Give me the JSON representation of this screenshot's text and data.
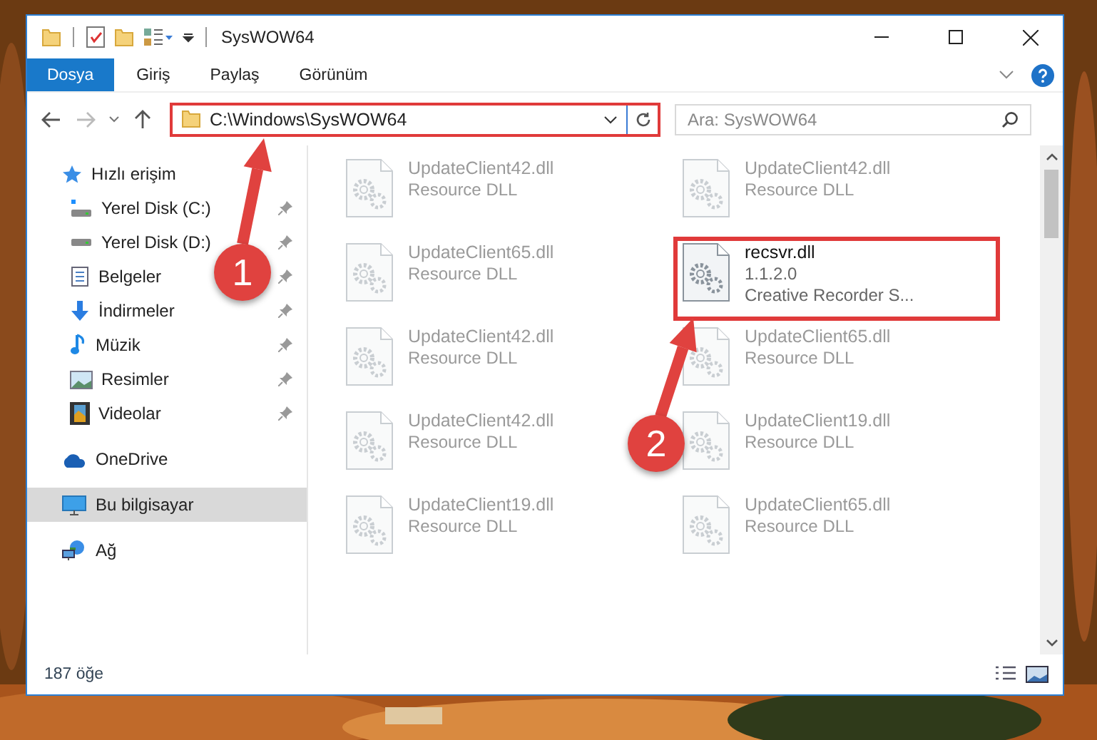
{
  "window": {
    "title": "SysWOW64"
  },
  "ribbon_tabs": [
    {
      "label": "Dosya",
      "selected": true
    },
    {
      "label": "Giriş",
      "selected": false
    },
    {
      "label": "Paylaş",
      "selected": false
    },
    {
      "label": "Görünüm",
      "selected": false
    }
  ],
  "navigation": {
    "back_disabled": false,
    "forward_disabled": true
  },
  "address": {
    "path": "C:\\Windows\\SysWOW64",
    "highlighted": true
  },
  "search": {
    "placeholder": "Ara: SysWOW64"
  },
  "sidebar": {
    "items": [
      {
        "label": "Hızlı erişim",
        "selected": false,
        "children": [
          {
            "label": "Yerel Disk (C:)",
            "pinned": true
          },
          {
            "label": "Yerel Disk (D:)",
            "pinned": true
          },
          {
            "label": "Belgeler",
            "pinned": true
          },
          {
            "label": "İndirmeler",
            "pinned": true
          },
          {
            "label": "Müzik",
            "pinned": true
          },
          {
            "label": "Resimler",
            "pinned": true
          },
          {
            "label": "Videolar",
            "pinned": true
          }
        ]
      },
      {
        "label": "OneDrive",
        "selected": false
      },
      {
        "label": "Bu bilgisayar",
        "selected": true
      },
      {
        "label": "Ağ",
        "selected": false
      }
    ]
  },
  "files": [
    {
      "name": "UpdateClient42.dll",
      "details": [
        "Resource DLL"
      ],
      "blurred": true,
      "highlighted": false
    },
    {
      "name": "UpdateClient42.dll",
      "details": [
        "Resource DLL"
      ],
      "blurred": true,
      "highlighted": false
    },
    {
      "name": "UpdateClient65.dll",
      "details": [
        "Resource DLL"
      ],
      "blurred": true,
      "highlighted": false
    },
    {
      "name": "recsvr.dll",
      "details": [
        "1.1.2.0",
        "Creative Recorder S..."
      ],
      "blurred": false,
      "highlighted": true
    },
    {
      "name": "UpdateClient42.dll",
      "details": [
        "Resource DLL"
      ],
      "blurred": true,
      "highlighted": false
    },
    {
      "name": "UpdateClient65.dll",
      "details": [
        "Resource DLL"
      ],
      "blurred": true,
      "highlighted": false
    },
    {
      "name": "UpdateClient42.dll",
      "details": [
        "Resource DLL"
      ],
      "blurred": true,
      "highlighted": false
    },
    {
      "name": "UpdateClient19.dll",
      "details": [
        "Resource DLL"
      ],
      "blurred": true,
      "highlighted": false
    },
    {
      "name": "UpdateClient19.dll",
      "details": [
        "Resource DLL"
      ],
      "blurred": true,
      "highlighted": false
    },
    {
      "name": "UpdateClient65.dll",
      "details": [
        "Resource DLL"
      ],
      "blurred": true,
      "highlighted": false
    }
  ],
  "status_bar": {
    "item_count": "187 öğe"
  },
  "annotations": [
    {
      "number": "1"
    },
    {
      "number": "2"
    }
  ]
}
